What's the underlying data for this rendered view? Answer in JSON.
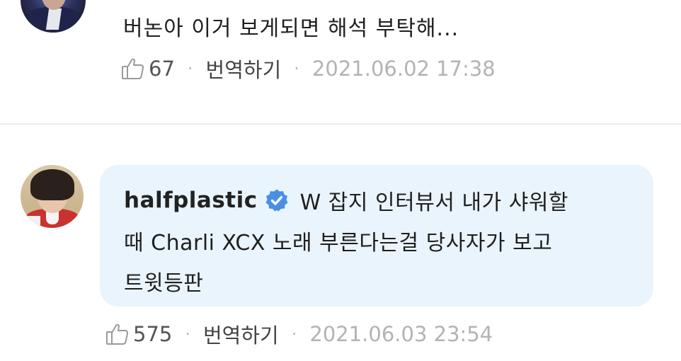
{
  "comments": [
    {
      "text": "버논아 이거 보게되면 해석 부탁해...",
      "likes": "67",
      "translate_label": "번역하기",
      "timestamp": "2021.06.02 17:38"
    },
    {
      "username": "halfplastic",
      "verified": true,
      "lines": [
        "W 잡지 인터뷰서 내가 샤워할",
        "때 Charli XCX 노래 부른다는걸 당사자가 보고",
        "트윗등판"
      ],
      "likes": "575",
      "translate_label": "번역하기",
      "timestamp": "2021.06.03 23:54"
    }
  ],
  "icons": {
    "like": "thumbs-up-icon",
    "verified": "verified-badge-icon",
    "separator": "·"
  },
  "colors": {
    "bubble_bg": "#eaf4fc",
    "verified_blue": "#4a90e2",
    "timestamp_gray": "#b3b3b3"
  }
}
